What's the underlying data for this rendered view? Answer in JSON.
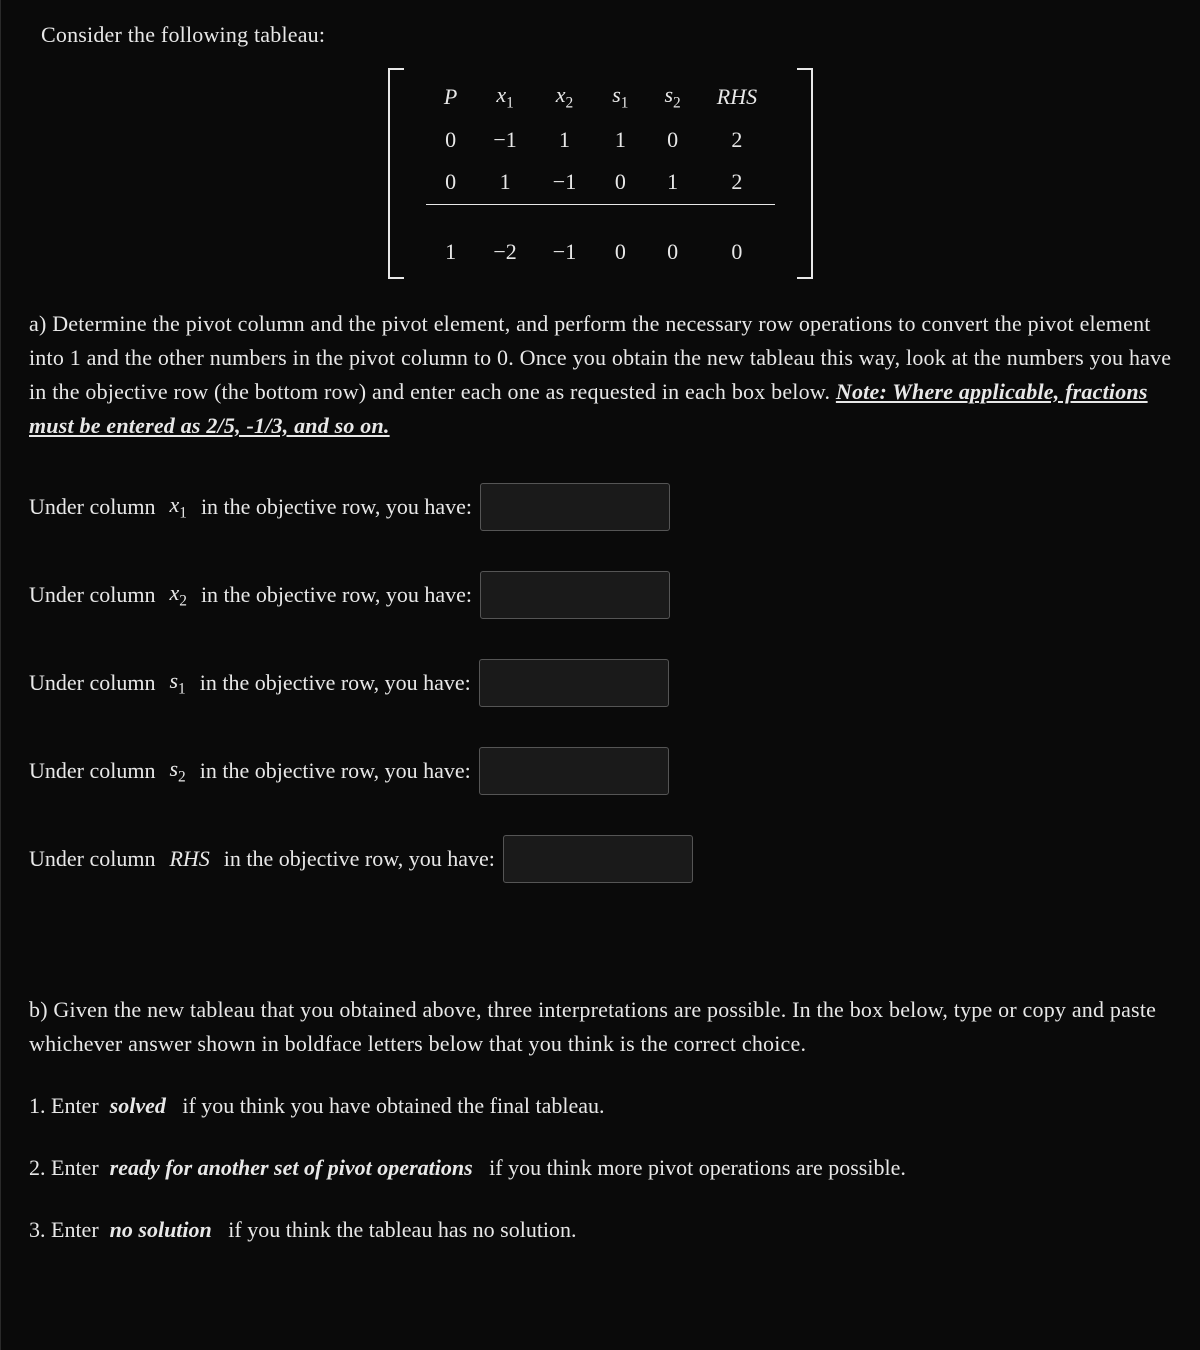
{
  "intro": "Consider the following tableau:",
  "tableau": {
    "header": [
      "P",
      "x1",
      "x2",
      "s1",
      "s2",
      "RHS"
    ],
    "rows": [
      [
        "0",
        "−1",
        "1",
        "1",
        "0",
        "2"
      ],
      [
        "0",
        "1",
        "−1",
        "0",
        "1",
        "2"
      ]
    ],
    "objective": [
      "1",
      "−2",
      "−1",
      "0",
      "0",
      "0"
    ]
  },
  "partA": {
    "lead": "a) Determine the pivot column and the pivot element, and perform the necessary row operations to convert the pivot element into 1 and the other numbers in the pivot column to 0. Once you obtain the new tableau this way, look at the numbers you have in the objective row (the bottom row) and enter each one as requested in each box below. ",
    "note": "Note: Where applicable, fractions must be entered as   2/5,   -1/3, and so on."
  },
  "prompts": {
    "prefix": "Under column",
    "suffix": "in the objective row, you have:",
    "cols": {
      "x1": "x1",
      "x2": "x2",
      "s1": "s1",
      "s2": "s2",
      "rhs": "RHS"
    }
  },
  "partB": {
    "lead": "b) Given the new tableau that you obtained above, three interpretations are possible. In the box below, type or copy and paste whichever answer shown in boldface letters below that you think is the correct choice.",
    "options": [
      {
        "n": "1.",
        "pre": "Enter",
        "key": "solved",
        "post": "if you think you have obtained the final tableau."
      },
      {
        "n": "2.",
        "pre": "Enter",
        "key": "ready for another set of pivot operations",
        "post": "if you think more pivot operations are possible."
      },
      {
        "n": "3.",
        "pre": "Enter",
        "key": "no solution",
        "post": "if you think the tableau has no solution."
      }
    ]
  }
}
